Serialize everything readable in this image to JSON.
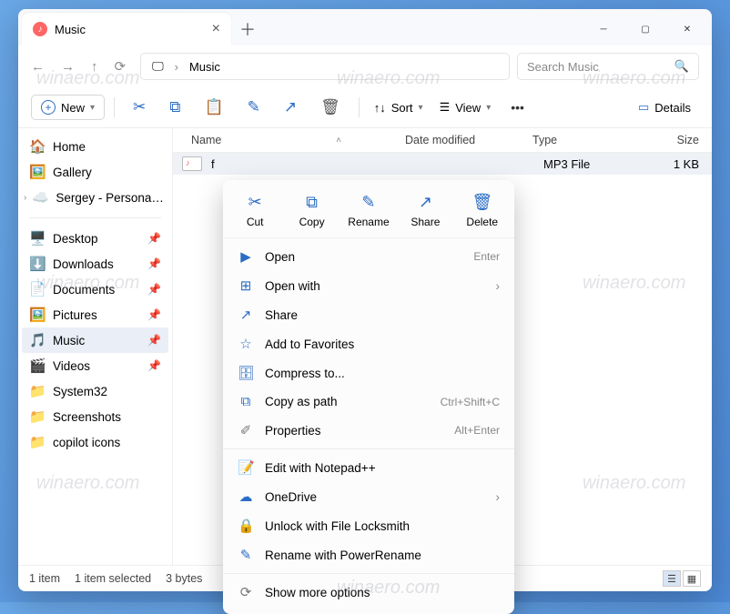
{
  "tab": {
    "title": "Music"
  },
  "path": {
    "current": "Music"
  },
  "search": {
    "placeholder": "Search Music"
  },
  "toolbar": {
    "new": "New",
    "sort": "Sort",
    "view": "View",
    "details": "Details"
  },
  "sidebar": {
    "top": [
      {
        "icon": "🏠",
        "label": "Home"
      },
      {
        "icon": "🖼️",
        "label": "Gallery"
      },
      {
        "icon": "☁️",
        "label": "Sergey - Persona…"
      }
    ],
    "pinned": [
      {
        "icon": "🖥️",
        "label": "Desktop"
      },
      {
        "icon": "⬇️",
        "label": "Downloads"
      },
      {
        "icon": "📄",
        "label": "Documents"
      },
      {
        "icon": "🖼️",
        "label": "Pictures"
      },
      {
        "icon": "🎵",
        "label": "Music",
        "sel": true
      },
      {
        "icon": "🎬",
        "label": "Videos"
      },
      {
        "icon": "📁",
        "label": "System32"
      },
      {
        "icon": "📁",
        "label": "Screenshots"
      },
      {
        "icon": "📁",
        "label": "copilot icons"
      }
    ]
  },
  "columns": {
    "name": "Name",
    "date": "Date modified",
    "type": "Type",
    "size": "Size"
  },
  "file": {
    "name": "f",
    "type": "MP3 File",
    "size": "1 KB"
  },
  "status": {
    "count": "1 item",
    "sel": "1 item selected",
    "bytes": "3 bytes"
  },
  "ctx": {
    "top": [
      {
        "icon": "✂",
        "label": "Cut"
      },
      {
        "icon": "⧉",
        "label": "Copy"
      },
      {
        "icon": "✎",
        "label": "Rename"
      },
      {
        "icon": "↗",
        "label": "Share"
      },
      {
        "icon": "🗑",
        "label": "Delete"
      }
    ],
    "items": [
      {
        "icon": "▶",
        "label": "Open",
        "short": "Enter"
      },
      {
        "icon": "⊞",
        "label": "Open with",
        "sub": true
      },
      {
        "icon": "↗",
        "label": "Share"
      },
      {
        "icon": "☆",
        "label": "Add to Favorites"
      },
      {
        "icon": "🗄",
        "label": "Compress to..."
      },
      {
        "icon": "⧉",
        "label": "Copy as path",
        "short": "Ctrl+Shift+C"
      },
      {
        "icon": "✐",
        "label": "Properties",
        "short": "Alt+Enter",
        "gray": true
      }
    ],
    "ext": [
      {
        "icon": "📝",
        "label": "Edit with Notepad++"
      },
      {
        "icon": "☁",
        "label": "OneDrive",
        "sub": true
      },
      {
        "icon": "🔒",
        "label": "Unlock with File Locksmith",
        "gray": true
      },
      {
        "icon": "✎",
        "label": "Rename with PowerRename"
      }
    ],
    "more": {
      "icon": "⟳",
      "label": "Show more options"
    }
  },
  "watermarks": [
    "winaero.com",
    "winaero.com",
    "winaero.com",
    "winaero.com",
    "winaero.com",
    "winaero.com",
    "winaero.com",
    "winaero.com",
    "winaero.com"
  ]
}
